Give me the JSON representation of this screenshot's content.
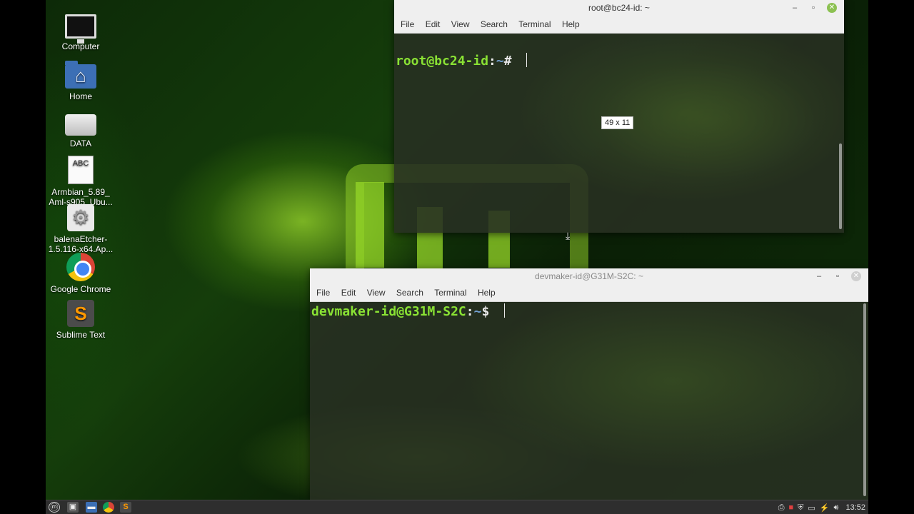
{
  "desktop": {
    "icons": [
      {
        "label": "Computer"
      },
      {
        "label": "Home"
      },
      {
        "label": "DATA"
      },
      {
        "label": "Armbian_5.89_\nAml-s905_Ubu...",
        "line1": "Armbian_5.89_",
        "line2": "Aml-s905_Ubu...",
        "glyph_text": "ABC"
      },
      {
        "label": "balenaEtcher-1.5.116-x64.Ap...",
        "line1": "balenaEtcher-",
        "line2": "1.5.116-x64.Ap..."
      },
      {
        "label": "Google Chrome"
      },
      {
        "label": "Sublime Text",
        "glyph_text": "S"
      }
    ]
  },
  "terminal_root": {
    "title": "root@bc24-id: ~",
    "menu": [
      "File",
      "Edit",
      "View",
      "Search",
      "Terminal",
      "Help"
    ],
    "prompt_user": "root@bc24-id",
    "prompt_sep": ":",
    "prompt_path": "~",
    "prompt_symbol": "# ",
    "size_tooltip": "49 x 11"
  },
  "terminal_dev": {
    "title": "devmaker-id@G31M-S2C: ~",
    "menu": [
      "File",
      "Edit",
      "View",
      "Search",
      "Terminal",
      "Help"
    ],
    "prompt_user": "devmaker-id@G31M-S2C",
    "prompt_sep": ":",
    "prompt_path": "~",
    "prompt_symbol": "$ "
  },
  "taskbar": {
    "clock": "13:52",
    "tray_icons": [
      "printer-icon",
      "record-icon",
      "shield-icon",
      "keyboard-icon",
      "network-icon",
      "volume-icon"
    ]
  },
  "colors": {
    "prompt_user": "#8ae234",
    "prompt_path": "#729fcf",
    "close_active": "#8cc152"
  }
}
